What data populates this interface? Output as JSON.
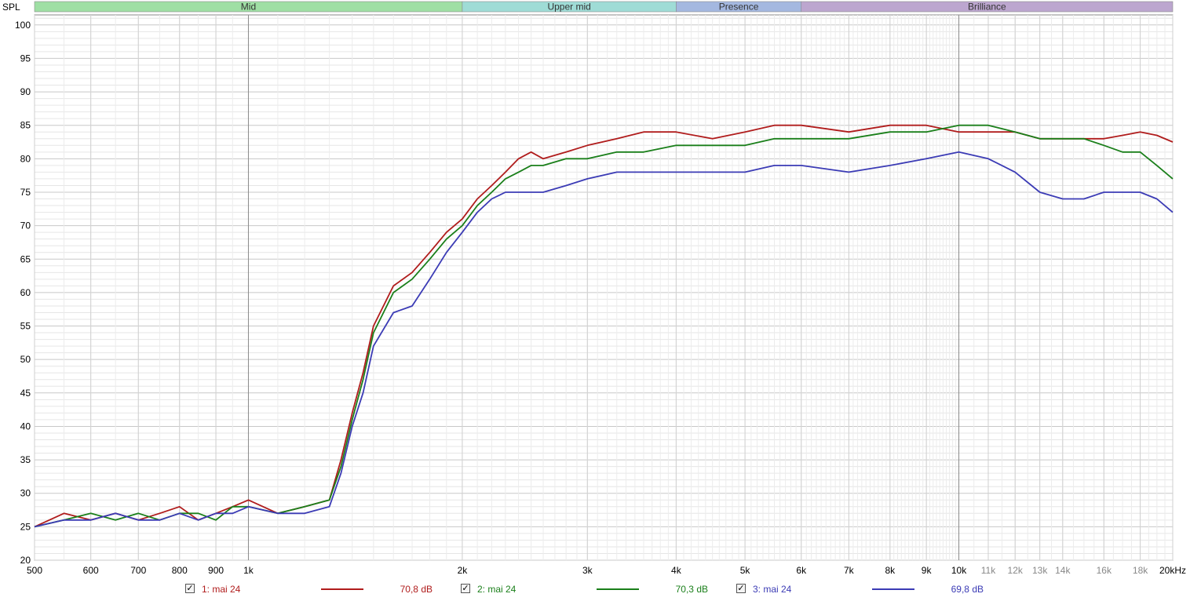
{
  "chart_data": {
    "type": "line",
    "ylabel": "SPL",
    "x_unit_label": "kHz",
    "x_scale": "log",
    "xlim": [
      500,
      20000
    ],
    "ylim": [
      20,
      101.5
    ],
    "y_ticks": [
      20,
      25,
      30,
      35,
      40,
      45,
      50,
      55,
      60,
      65,
      70,
      75,
      80,
      85,
      90,
      95,
      100
    ],
    "y_tick_labels": [
      "20",
      "25",
      "30",
      "35",
      "40",
      "45",
      "50",
      "55",
      "60",
      "65",
      "70",
      "75",
      "80",
      "85",
      "90",
      "95",
      "100"
    ],
    "x_ticks": [
      500,
      600,
      700,
      800,
      900,
      1000,
      2000,
      3000,
      4000,
      5000,
      6000,
      7000,
      8000,
      9000,
      10000,
      11000,
      12000,
      13000,
      14000,
      16000,
      18000,
      20000
    ],
    "x_tick_labels": [
      "500",
      "600",
      "700",
      "800",
      "900",
      "1k",
      "2k",
      "3k",
      "4k",
      "5k",
      "6k",
      "7k",
      "8k",
      "9k",
      "10k",
      "11k",
      "12k",
      "13k",
      "14k",
      "16k",
      "18k",
      "20kHz"
    ],
    "grid": true,
    "bands": [
      {
        "label": "Mid",
        "from": 500,
        "to": 2000,
        "color": "#9fdfa4"
      },
      {
        "label": "Upper mid",
        "from": 2000,
        "to": 4000,
        "color": "#9fdcd6"
      },
      {
        "label": "Presence",
        "from": 4000,
        "to": 6000,
        "color": "#a4b8e0"
      },
      {
        "label": "Brilliance",
        "from": 6000,
        "to": 20000,
        "color": "#bca6cf"
      }
    ],
    "series": [
      {
        "name": "1: mai 24",
        "color": "#b01c1c",
        "avg_label": "70,8 dB",
        "x": [
          500,
          550,
          600,
          650,
          700,
          750,
          800,
          850,
          900,
          950,
          1000,
          1100,
          1200,
          1300,
          1350,
          1400,
          1450,
          1500,
          1600,
          1700,
          1800,
          1900,
          2000,
          2100,
          2200,
          2300,
          2400,
          2500,
          2600,
          2800,
          3000,
          3300,
          3600,
          4000,
          4500,
          5000,
          5500,
          6000,
          7000,
          8000,
          9000,
          10000,
          11000,
          12000,
          13000,
          14000,
          15000,
          16000,
          17000,
          18000,
          19000,
          20000
        ],
        "y": [
          25,
          27,
          26,
          27,
          26,
          27,
          28,
          26,
          27,
          28,
          29,
          27,
          28,
          29,
          35,
          42,
          48,
          55,
          61,
          63,
          66,
          69,
          71,
          74,
          76,
          78,
          80,
          81,
          80,
          81,
          82,
          83,
          84,
          84,
          83,
          84,
          85,
          85,
          84,
          85,
          85,
          84,
          84,
          84,
          83,
          83,
          83,
          83,
          83.5,
          84,
          83.5,
          82.5
        ]
      },
      {
        "name": "2: mai 24",
        "color": "#1a7f1a",
        "avg_label": "70,3 dB",
        "x": [
          500,
          550,
          600,
          650,
          700,
          750,
          800,
          850,
          900,
          950,
          1000,
          1100,
          1200,
          1300,
          1350,
          1400,
          1450,
          1500,
          1600,
          1700,
          1800,
          1900,
          2000,
          2100,
          2200,
          2300,
          2400,
          2500,
          2600,
          2800,
          3000,
          3300,
          3600,
          4000,
          4500,
          5000,
          5500,
          6000,
          7000,
          8000,
          9000,
          10000,
          11000,
          12000,
          13000,
          14000,
          15000,
          16000,
          17000,
          18000,
          19000,
          20000
        ],
        "y": [
          25,
          26,
          27,
          26,
          27,
          26,
          27,
          27,
          26,
          28,
          28,
          27,
          28,
          29,
          34,
          41,
          47,
          54,
          60,
          62,
          65,
          68,
          70,
          73,
          75,
          77,
          78,
          79,
          79,
          80,
          80,
          81,
          81,
          82,
          82,
          82,
          83,
          83,
          83,
          84,
          84,
          85,
          85,
          84,
          83,
          83,
          83,
          82,
          81,
          81,
          79,
          77
        ]
      },
      {
        "name": "3: mai 24",
        "color": "#3b3bb5",
        "avg_label": "69,8 dB",
        "x": [
          500,
          550,
          600,
          650,
          700,
          750,
          800,
          850,
          900,
          950,
          1000,
          1100,
          1200,
          1300,
          1350,
          1400,
          1450,
          1500,
          1600,
          1700,
          1800,
          1900,
          2000,
          2100,
          2200,
          2300,
          2400,
          2500,
          2600,
          2800,
          3000,
          3300,
          3600,
          4000,
          4500,
          5000,
          5500,
          6000,
          7000,
          8000,
          9000,
          10000,
          11000,
          12000,
          13000,
          14000,
          15000,
          16000,
          17000,
          18000,
          19000,
          20000
        ],
        "y": [
          25,
          26,
          26,
          27,
          26,
          26,
          27,
          26,
          27,
          27,
          28,
          27,
          27,
          28,
          33,
          40,
          45,
          52,
          57,
          58,
          62,
          66,
          69,
          72,
          74,
          75,
          75,
          75,
          75,
          76,
          77,
          78,
          78,
          78,
          78,
          78,
          79,
          79,
          78,
          79,
          80,
          81,
          80,
          78,
          75,
          74,
          74,
          75,
          75,
          75,
          74,
          72
        ]
      }
    ]
  }
}
